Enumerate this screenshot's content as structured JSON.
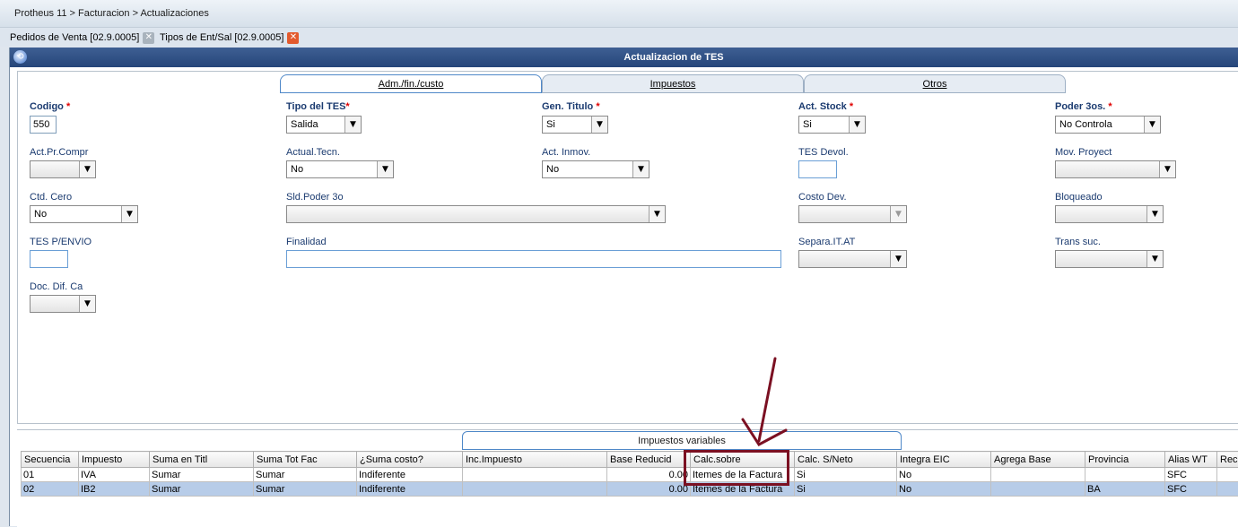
{
  "breadcrumb": "Protheus 11 > Facturacion > Actualizaciones",
  "doc_tabs": [
    {
      "label": "Pedidos de Venta [02.9.0005]",
      "close": "✕"
    },
    {
      "label": "Tipos de Ent/Sal [02.9.0005]",
      "close": "✕"
    }
  ],
  "window": {
    "title": "Actualizacion de TES"
  },
  "form_tabs": [
    "Adm./fin./custo",
    "Impuestos",
    "Otros"
  ],
  "required_mark": "*",
  "fields": {
    "codigo": {
      "label": "Codigo",
      "value": "550"
    },
    "tipo_tes": {
      "label": "Tipo del TES",
      "value": "Salida"
    },
    "gen_titulo": {
      "label": "Gen. Titulo",
      "value": "Si"
    },
    "act_stock": {
      "label": "Act. Stock",
      "value": "Si"
    },
    "poder_3os": {
      "label": "Poder 3os.",
      "value": "No Controla"
    },
    "act_pr_compr": {
      "label": "Act.Pr.Compr",
      "value": ""
    },
    "actual_tecn": {
      "label": "Actual.Tecn.",
      "value": "No"
    },
    "act_inmov": {
      "label": "Act. Inmov.",
      "value": "No"
    },
    "tes_devol": {
      "label": "TES Devol.",
      "value": ""
    },
    "mov_proyect": {
      "label": "Mov. Proyect",
      "value": ""
    },
    "ctd_cero": {
      "label": "Ctd. Cero",
      "value": "No"
    },
    "sld_poder_3o": {
      "label": "Sld.Poder 3o",
      "value": ""
    },
    "costo_dev": {
      "label": "Costo Dev.",
      "value": ""
    },
    "bloqueado": {
      "label": "Bloqueado",
      "value": ""
    },
    "tes_penvio": {
      "label": "TES P/ENVIO",
      "value": ""
    },
    "finalidad": {
      "label": "Finalidad",
      "value": ""
    },
    "separa_it_at": {
      "label": "Separa.IT.AT",
      "value": ""
    },
    "trans_suc": {
      "label": "Trans suc.",
      "value": ""
    },
    "doc_dif_ca": {
      "label": "Doc. Dif. Ca",
      "value": ""
    }
  },
  "grid": {
    "tab_label": "Impuestos variables",
    "columns": [
      "Secuencia",
      "Impuesto",
      "Suma en Titl",
      "Suma Tot Fac",
      "¿Suma costo?",
      "Inc.Impuesto",
      "Base Reducid",
      "Calc.sobre",
      "Calc. S/Neto",
      "Integra EIC",
      "Agrega Base",
      "Provincia",
      "Alias WT",
      "Recn"
    ],
    "rows": [
      [
        "01",
        "IVA",
        "Sumar",
        "Sumar",
        "Indiferente",
        "",
        "0.00",
        "Itemes de la Factura",
        "Si",
        "No",
        "",
        "",
        "SFC",
        ""
      ],
      [
        "02",
        "IB2",
        "Sumar",
        "Sumar",
        "Indiferente",
        "",
        "0.00",
        "Itemes de la Factura",
        "Si",
        "No",
        "",
        "BA",
        "SFC",
        ""
      ]
    ],
    "selected_row": 1
  },
  "icons": {
    "dropdown": "▼",
    "window": "⟲"
  },
  "colors": {
    "titlebar": "#26467a",
    "label": "#1b3b70",
    "required": "#e00000",
    "annotation": "#7b1022",
    "selected_row": "#b7cce8"
  }
}
